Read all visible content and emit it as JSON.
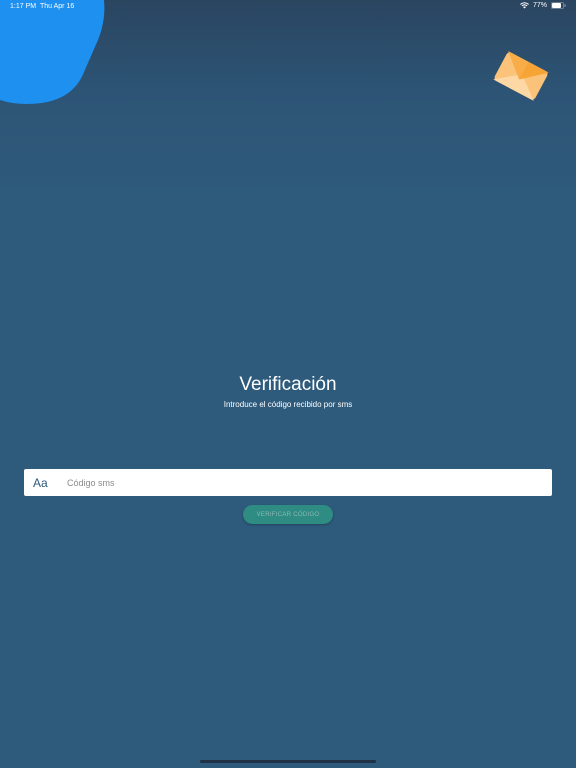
{
  "status_bar": {
    "time": "1:17 PM",
    "date": "Thu Apr 16",
    "battery": "77%",
    "icons": [
      "wifi-icon",
      "battery-icon"
    ]
  },
  "header": {
    "title": "Verificación",
    "subtitle": "Introduce el código recibido por sms"
  },
  "form": {
    "input_icon_text": "Aa",
    "input_placeholder": "Código sms",
    "input_value": "",
    "verify_label": "VERIFICAR CÓDIGO"
  },
  "colors": {
    "background": "#2e5a7c",
    "accent_blob": "#1e90f0",
    "button": "#2e8c82",
    "envelope_orange": "#f7a436"
  },
  "decor_icons": [
    "envelope-icon"
  ]
}
